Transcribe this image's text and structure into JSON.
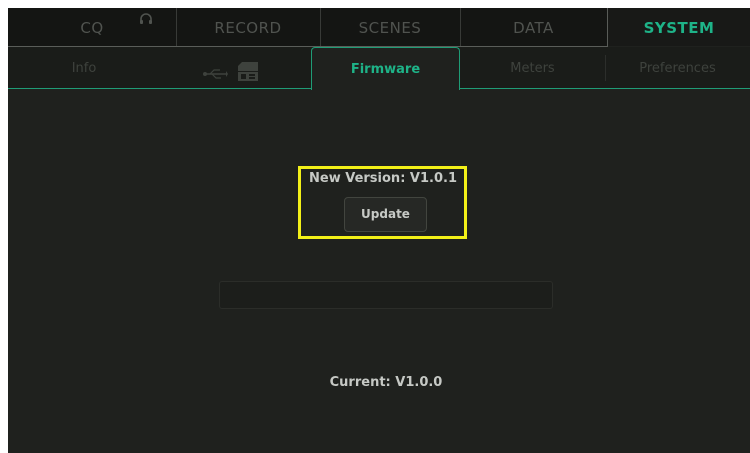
{
  "top_tabs": [
    {
      "label": "CQ",
      "active": false
    },
    {
      "label": "RECORD",
      "active": false
    },
    {
      "label": "SCENES",
      "active": false
    },
    {
      "label": "DATA",
      "active": false
    },
    {
      "label": "SYSTEM",
      "active": true
    }
  ],
  "sub_tabs": [
    {
      "label": "Info",
      "active": false
    },
    {
      "label": "",
      "icons": [
        "usb-icon",
        "sd-card-icon"
      ],
      "active": false
    },
    {
      "label": "Firmware",
      "active": true
    },
    {
      "label": "Meters",
      "active": false
    },
    {
      "label": "Preferences",
      "active": false
    }
  ],
  "firmware": {
    "new_version": "New Version: V1.0.1",
    "update_label": "Update",
    "progress": 0,
    "current_version": "Current: V1.0.0"
  },
  "colors": {
    "accent": "#1eb388",
    "highlight": "#f2f018",
    "background": "#1f211e"
  }
}
